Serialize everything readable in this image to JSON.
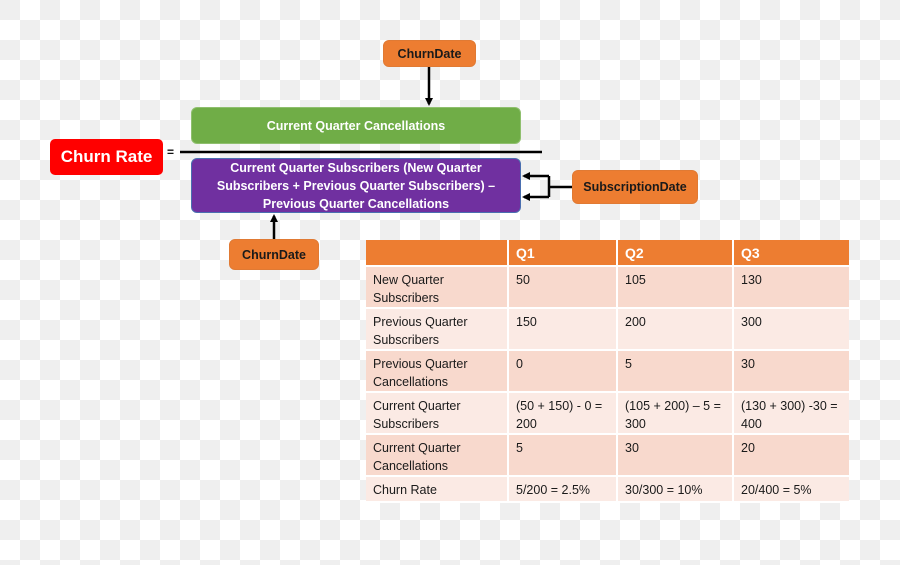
{
  "formula": {
    "result_label": "Churn Rate",
    "equals_sign": "=",
    "numerator": "Current Quarter Cancellations",
    "denominator": "Current Quarter Subscribers (New Quarter Subscribers + Previous Quarter Subscribers) – Previous Quarter Cancellations",
    "inputs": {
      "numerator_source": "ChurnDate",
      "denominator_source_bottom": "ChurnDate",
      "denominator_source_right": "SubscriptionDate"
    }
  },
  "colors": {
    "result": "#ff0000",
    "numerator": "#70ad47",
    "denominator": "#7030a0",
    "source_fields": "#ed7d31",
    "table_header": "#ed7d31",
    "table_row_odd": "#f8d9cd",
    "table_row_even": "#fbeae4"
  },
  "table": {
    "headers": [
      "",
      "Q1",
      "Q2",
      "Q3"
    ],
    "rows": [
      {
        "label": "New Quarter Subscribers",
        "values": [
          "50",
          "105",
          "130"
        ]
      },
      {
        "label": "Previous Quarter Subscribers",
        "values": [
          "150",
          "200",
          "300"
        ]
      },
      {
        "label": "Previous Quarter Cancellations",
        "values": [
          "0",
          "5",
          "30"
        ]
      },
      {
        "label": "Current Quarter Subscribers",
        "values": [
          "(50 + 150) - 0 = 200",
          "(105 + 200) – 5 = 300",
          "(130 + 300) -30 = 400"
        ]
      },
      {
        "label": "Current Quarter Cancellations",
        "values": [
          "5",
          "30",
          "20"
        ]
      },
      {
        "label": "Churn Rate",
        "values": [
          "5/200 = 2.5%",
          "30/300 = 10%",
          "20/400 = 5%"
        ]
      }
    ]
  }
}
